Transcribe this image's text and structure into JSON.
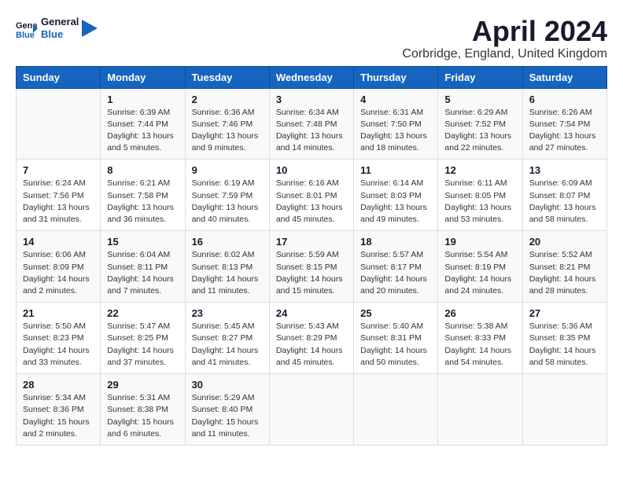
{
  "logo": {
    "general": "General",
    "blue": "Blue"
  },
  "header": {
    "month": "April 2024",
    "location": "Corbridge, England, United Kingdom"
  },
  "weekdays": [
    "Sunday",
    "Monday",
    "Tuesday",
    "Wednesday",
    "Thursday",
    "Friday",
    "Saturday"
  ],
  "weeks": [
    [
      {
        "day": "",
        "lines": []
      },
      {
        "day": "1",
        "lines": [
          "Sunrise: 6:39 AM",
          "Sunset: 7:44 PM",
          "Daylight: 13 hours",
          "and 5 minutes."
        ]
      },
      {
        "day": "2",
        "lines": [
          "Sunrise: 6:36 AM",
          "Sunset: 7:46 PM",
          "Daylight: 13 hours",
          "and 9 minutes."
        ]
      },
      {
        "day": "3",
        "lines": [
          "Sunrise: 6:34 AM",
          "Sunset: 7:48 PM",
          "Daylight: 13 hours",
          "and 14 minutes."
        ]
      },
      {
        "day": "4",
        "lines": [
          "Sunrise: 6:31 AM",
          "Sunset: 7:50 PM",
          "Daylight: 13 hours",
          "and 18 minutes."
        ]
      },
      {
        "day": "5",
        "lines": [
          "Sunrise: 6:29 AM",
          "Sunset: 7:52 PM",
          "Daylight: 13 hours",
          "and 22 minutes."
        ]
      },
      {
        "day": "6",
        "lines": [
          "Sunrise: 6:26 AM",
          "Sunset: 7:54 PM",
          "Daylight: 13 hours",
          "and 27 minutes."
        ]
      }
    ],
    [
      {
        "day": "7",
        "lines": [
          "Sunrise: 6:24 AM",
          "Sunset: 7:56 PM",
          "Daylight: 13 hours",
          "and 31 minutes."
        ]
      },
      {
        "day": "8",
        "lines": [
          "Sunrise: 6:21 AM",
          "Sunset: 7:58 PM",
          "Daylight: 13 hours",
          "and 36 minutes."
        ]
      },
      {
        "day": "9",
        "lines": [
          "Sunrise: 6:19 AM",
          "Sunset: 7:59 PM",
          "Daylight: 13 hours",
          "and 40 minutes."
        ]
      },
      {
        "day": "10",
        "lines": [
          "Sunrise: 6:16 AM",
          "Sunset: 8:01 PM",
          "Daylight: 13 hours",
          "and 45 minutes."
        ]
      },
      {
        "day": "11",
        "lines": [
          "Sunrise: 6:14 AM",
          "Sunset: 8:03 PM",
          "Daylight: 13 hours",
          "and 49 minutes."
        ]
      },
      {
        "day": "12",
        "lines": [
          "Sunrise: 6:11 AM",
          "Sunset: 8:05 PM",
          "Daylight: 13 hours",
          "and 53 minutes."
        ]
      },
      {
        "day": "13",
        "lines": [
          "Sunrise: 6:09 AM",
          "Sunset: 8:07 PM",
          "Daylight: 13 hours",
          "and 58 minutes."
        ]
      }
    ],
    [
      {
        "day": "14",
        "lines": [
          "Sunrise: 6:06 AM",
          "Sunset: 8:09 PM",
          "Daylight: 14 hours",
          "and 2 minutes."
        ]
      },
      {
        "day": "15",
        "lines": [
          "Sunrise: 6:04 AM",
          "Sunset: 8:11 PM",
          "Daylight: 14 hours",
          "and 7 minutes."
        ]
      },
      {
        "day": "16",
        "lines": [
          "Sunrise: 6:02 AM",
          "Sunset: 8:13 PM",
          "Daylight: 14 hours",
          "and 11 minutes."
        ]
      },
      {
        "day": "17",
        "lines": [
          "Sunrise: 5:59 AM",
          "Sunset: 8:15 PM",
          "Daylight: 14 hours",
          "and 15 minutes."
        ]
      },
      {
        "day": "18",
        "lines": [
          "Sunrise: 5:57 AM",
          "Sunset: 8:17 PM",
          "Daylight: 14 hours",
          "and 20 minutes."
        ]
      },
      {
        "day": "19",
        "lines": [
          "Sunrise: 5:54 AM",
          "Sunset: 8:19 PM",
          "Daylight: 14 hours",
          "and 24 minutes."
        ]
      },
      {
        "day": "20",
        "lines": [
          "Sunrise: 5:52 AM",
          "Sunset: 8:21 PM",
          "Daylight: 14 hours",
          "and 28 minutes."
        ]
      }
    ],
    [
      {
        "day": "21",
        "lines": [
          "Sunrise: 5:50 AM",
          "Sunset: 8:23 PM",
          "Daylight: 14 hours",
          "and 33 minutes."
        ]
      },
      {
        "day": "22",
        "lines": [
          "Sunrise: 5:47 AM",
          "Sunset: 8:25 PM",
          "Daylight: 14 hours",
          "and 37 minutes."
        ]
      },
      {
        "day": "23",
        "lines": [
          "Sunrise: 5:45 AM",
          "Sunset: 8:27 PM",
          "Daylight: 14 hours",
          "and 41 minutes."
        ]
      },
      {
        "day": "24",
        "lines": [
          "Sunrise: 5:43 AM",
          "Sunset: 8:29 PM",
          "Daylight: 14 hours",
          "and 45 minutes."
        ]
      },
      {
        "day": "25",
        "lines": [
          "Sunrise: 5:40 AM",
          "Sunset: 8:31 PM",
          "Daylight: 14 hours",
          "and 50 minutes."
        ]
      },
      {
        "day": "26",
        "lines": [
          "Sunrise: 5:38 AM",
          "Sunset: 8:33 PM",
          "Daylight: 14 hours",
          "and 54 minutes."
        ]
      },
      {
        "day": "27",
        "lines": [
          "Sunrise: 5:36 AM",
          "Sunset: 8:35 PM",
          "Daylight: 14 hours",
          "and 58 minutes."
        ]
      }
    ],
    [
      {
        "day": "28",
        "lines": [
          "Sunrise: 5:34 AM",
          "Sunset: 8:36 PM",
          "Daylight: 15 hours",
          "and 2 minutes."
        ]
      },
      {
        "day": "29",
        "lines": [
          "Sunrise: 5:31 AM",
          "Sunset: 8:38 PM",
          "Daylight: 15 hours",
          "and 6 minutes."
        ]
      },
      {
        "day": "30",
        "lines": [
          "Sunrise: 5:29 AM",
          "Sunset: 8:40 PM",
          "Daylight: 15 hours",
          "and 11 minutes."
        ]
      },
      {
        "day": "",
        "lines": []
      },
      {
        "day": "",
        "lines": []
      },
      {
        "day": "",
        "lines": []
      },
      {
        "day": "",
        "lines": []
      }
    ]
  ]
}
